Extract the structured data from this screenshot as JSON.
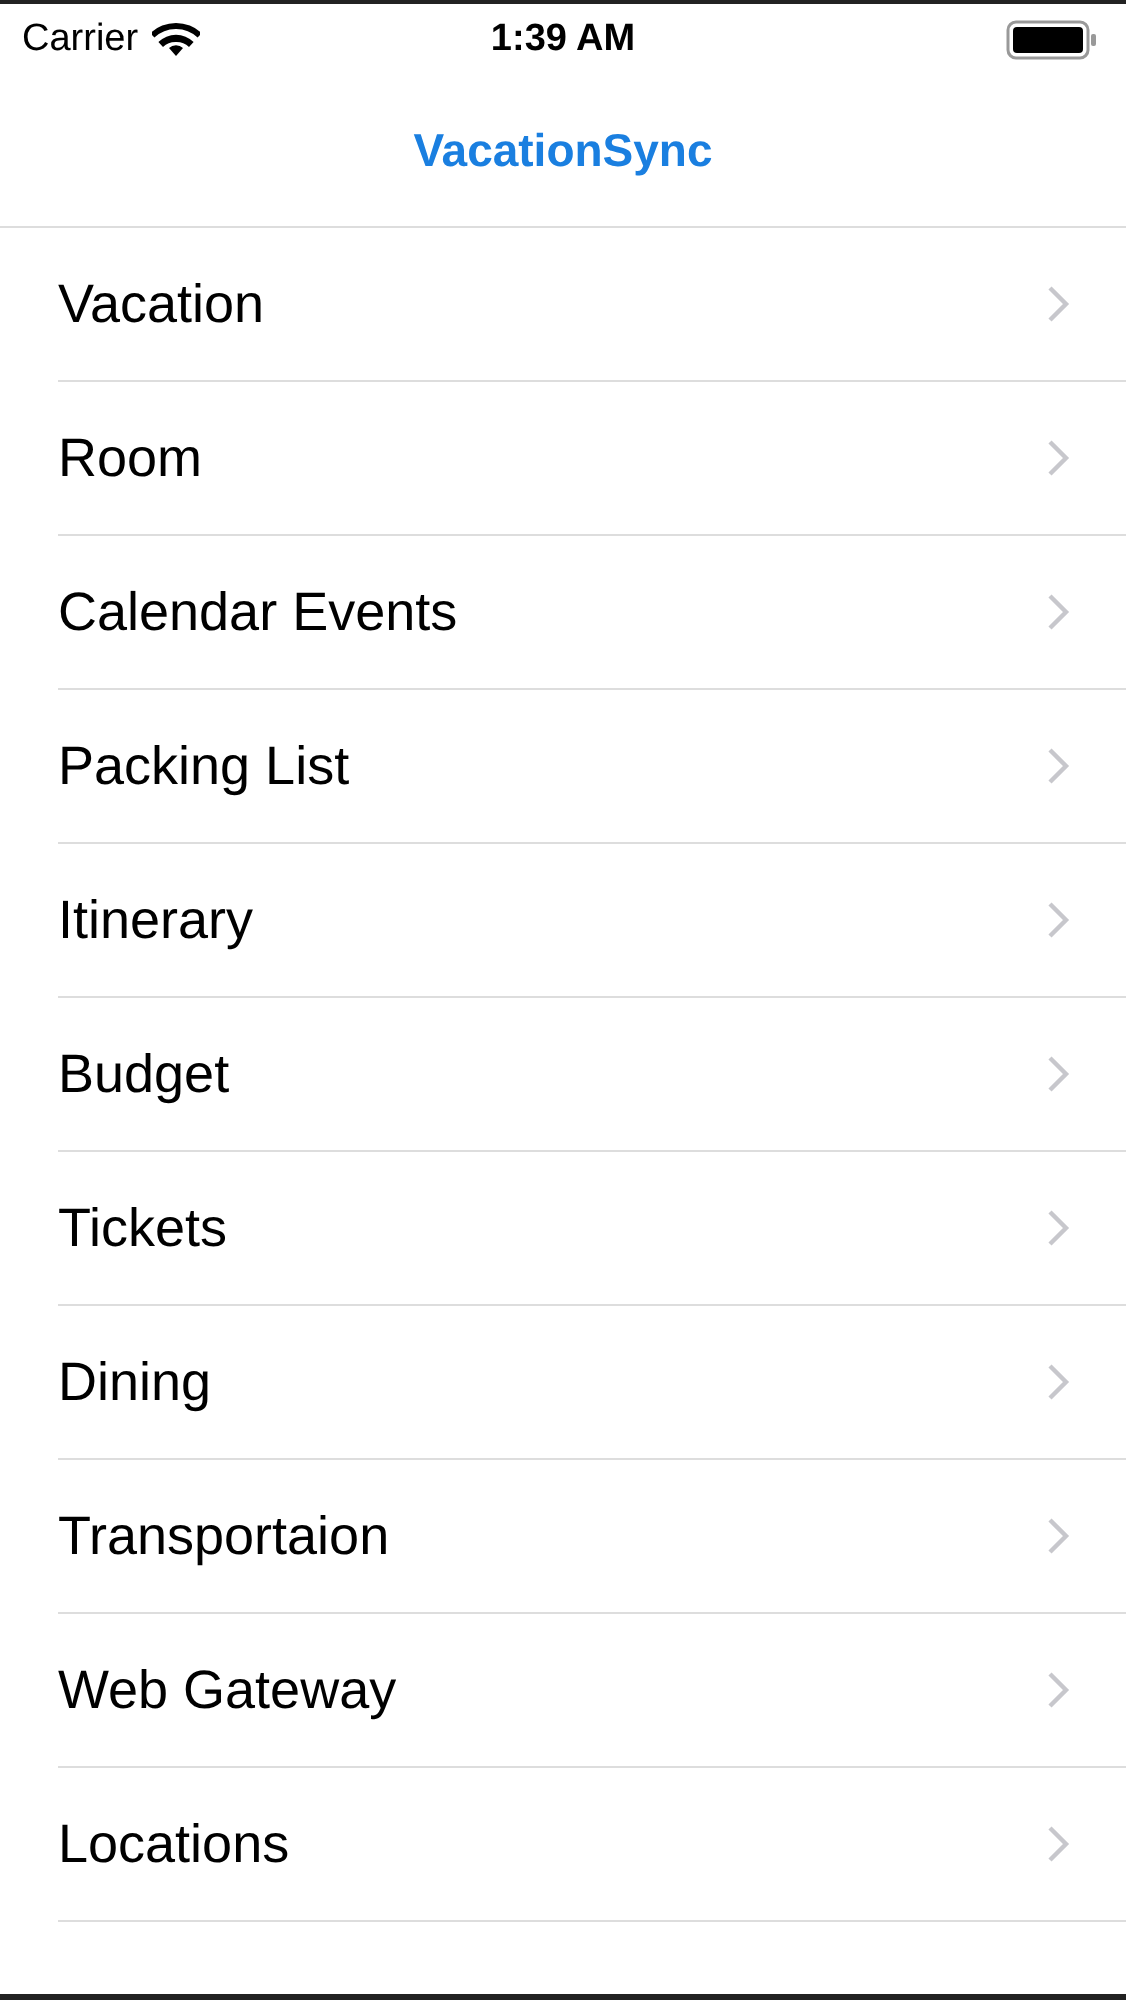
{
  "status_bar": {
    "carrier": "Carrier",
    "time": "1:39 AM"
  },
  "nav_bar": {
    "title": "VacationSync"
  },
  "menu_items": [
    {
      "label": "Vacation"
    },
    {
      "label": "Room"
    },
    {
      "label": "Calendar Events"
    },
    {
      "label": "Packing List"
    },
    {
      "label": "Itinerary"
    },
    {
      "label": "Budget"
    },
    {
      "label": "Tickets"
    },
    {
      "label": "Dining"
    },
    {
      "label": "Transportaion"
    },
    {
      "label": "Web Gateway"
    },
    {
      "label": "Locations"
    }
  ]
}
